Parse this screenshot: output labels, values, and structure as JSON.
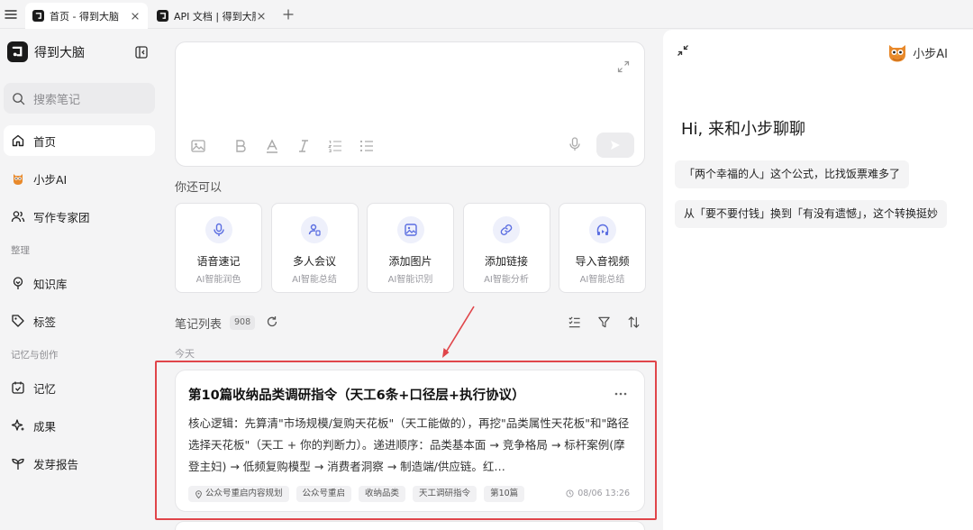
{
  "browser": {
    "tabs": [
      {
        "title": "首页 - 得到大脑",
        "active": true
      },
      {
        "title": "API 文档 | 得到大脑",
        "active": false
      }
    ]
  },
  "sidebar": {
    "brand": "得到大脑",
    "search_placeholder": "搜索笔记",
    "items": [
      {
        "label": "首页",
        "icon": "home-icon",
        "active": true
      },
      {
        "label": "小步AI",
        "icon": "owl-icon"
      },
      {
        "label": "写作专家团",
        "icon": "people-icon"
      },
      {
        "label": "知识库",
        "icon": "knowledge-icon"
      },
      {
        "label": "标签",
        "icon": "tag-icon"
      },
      {
        "label": "记忆",
        "icon": "memory-icon"
      },
      {
        "label": "成果",
        "icon": "sparkle-icon"
      },
      {
        "label": "发芽报告",
        "icon": "sprout-icon"
      }
    ],
    "sections": {
      "organize": "整理",
      "memory_create": "记忆与创作"
    }
  },
  "main": {
    "can_do_title": "你还可以",
    "quick_actions": [
      {
        "title": "语音速记",
        "subtitle": "AI智能润色",
        "icon": "microphone-icon"
      },
      {
        "title": "多人会议",
        "subtitle": "AI智能总结",
        "icon": "meeting-icon"
      },
      {
        "title": "添加图片",
        "subtitle": "AI智能识别",
        "icon": "image-icon"
      },
      {
        "title": "添加链接",
        "subtitle": "AI智能分析",
        "icon": "link-icon"
      },
      {
        "title": "导入音视频",
        "subtitle": "AI智能总结",
        "icon": "media-icon"
      }
    ],
    "notes_title": "笔记列表",
    "notes_count": "908",
    "day_label": "今天",
    "note": {
      "title": "第10篇收纳品类调研指令（天工6条+口径层+执行协议）",
      "body": "核心逻辑：先算清\"市场规模/复购天花板\"（天工能做的），再挖\"品类属性天花板\"和\"路径选择天花板\"（天工 + 你的判断力）。递进顺序：品类基本面 → 竞争格局 → 标杆案例(摩登主妇) → 低频复购模型 → 消费者洞察 → 制造端/供应链。红…",
      "tags": [
        "公众号重启内容规划",
        "公众号重启",
        "收纳品类",
        "天工调研指令",
        "第10篇"
      ],
      "time": "08/06 13:26"
    }
  },
  "ai_panel": {
    "name": "小步AI",
    "greeting": "Hi, 来和小步聊聊",
    "suggestions": [
      "「两个幸福的人」这个公式，比找饭票难多了",
      "从「要不要付钱」换到「有没有遗憾」，这个转换挺妙"
    ]
  },
  "colors": {
    "accent": "#5b6ee1",
    "highlight": "#e0454a"
  }
}
